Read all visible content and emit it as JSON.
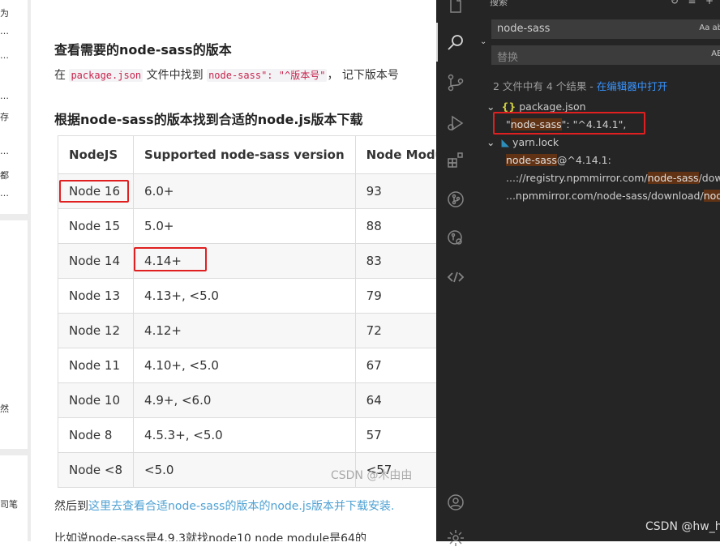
{
  "strip": {
    "chars": [
      "为",
      "…",
      "…",
      "…",
      "存",
      "…",
      "都",
      "…",
      "然",
      "司笔"
    ]
  },
  "article": {
    "heading1": "查看需要的node-sass的版本",
    "para1": {
      "pre": "在 ",
      "code1": "package.json",
      "mid": " 文件中找到 ",
      "code2": "node-sass\": \"^版本号\"",
      "post": "，  记下版本号"
    },
    "heading2": "根据node-sass的版本找到合适的node.js版本下载",
    "table": {
      "headers": [
        "NodeJS",
        "Supported node-sass version",
        "Node Module"
      ],
      "rows": [
        [
          "Node 16",
          "6.0+",
          "93"
        ],
        [
          "Node 15",
          "5.0+",
          "88"
        ],
        [
          "Node 14",
          "4.14+",
          "83"
        ],
        [
          "Node 13",
          "4.13+, <5.0",
          "79"
        ],
        [
          "Node 12",
          "4.12+",
          "72"
        ],
        [
          "Node 11",
          "4.10+, <5.0",
          "67"
        ],
        [
          "Node 10",
          "4.9+, <6.0",
          "64"
        ],
        [
          "Node 8",
          "4.5.3+, <5.0",
          "57"
        ],
        [
          "Node <8",
          "<5.0",
          "<57"
        ]
      ]
    },
    "para2": {
      "pre": "然后到",
      "link": "这里去查看合适node-sass的版本的node.js版本并下载安装."
    },
    "para3": "比如说node-sass是4.9.3就找node10 node module是64的",
    "watermark": "CSDN @木由由"
  },
  "vscode": {
    "panel_title": "搜索",
    "search_value": "node-sass",
    "search_opts": "Aa  ab",
    "replace_placeholder": "替换",
    "replace_opts": "AB",
    "summary": "2 文件中有 4 个结果 - ",
    "summary_link": "在编辑器中打开",
    "files": [
      {
        "name": "package.json",
        "results": [
          {
            "pre": "\"",
            "hl": "node-sass",
            "post": "\": \"^4.14.1\","
          }
        ]
      },
      {
        "name": "yarn.lock",
        "results": [
          {
            "pre": "",
            "hl": "node-sass",
            "post": "@^4.14.1:"
          },
          {
            "pre": "...://registry.npmmirror.com/",
            "hl": "node-sass",
            "post": "/downlo"
          },
          {
            "pre": "...npmmirror.com/node-sass/download/",
            "hl": "node-",
            "post": ""
          }
        ]
      }
    ],
    "watermark": "CSDN @hw_happy"
  }
}
